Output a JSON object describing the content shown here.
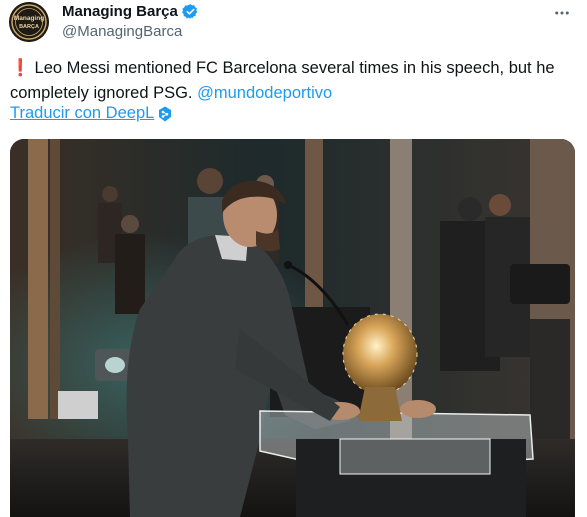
{
  "tweet": {
    "display_name": "Managing Barça",
    "handle": "@ManagingBarca",
    "text_alert_icon": "❗",
    "text_body": "Leo Messi mentioned FC Barcelona several times in his speech, but he completely ignored PSG.",
    "text_mention": "@mundodeportivo",
    "translate_link": "Traducir con DeepL"
  },
  "avatar": {
    "text_top": "Managing",
    "text_bottom": "BARÇA",
    "colors": {
      "background": "#1f1a13",
      "ring": "#c9a86a"
    }
  },
  "icons": {
    "verified": "verified-badge-icon",
    "more": "more-options-icon",
    "deepl": "deepl-icon"
  },
  "colors": {
    "accent": "#1d9bf0",
    "text": "#0f1419",
    "secondary_text": "#536471",
    "alert": "#dd2e44"
  }
}
